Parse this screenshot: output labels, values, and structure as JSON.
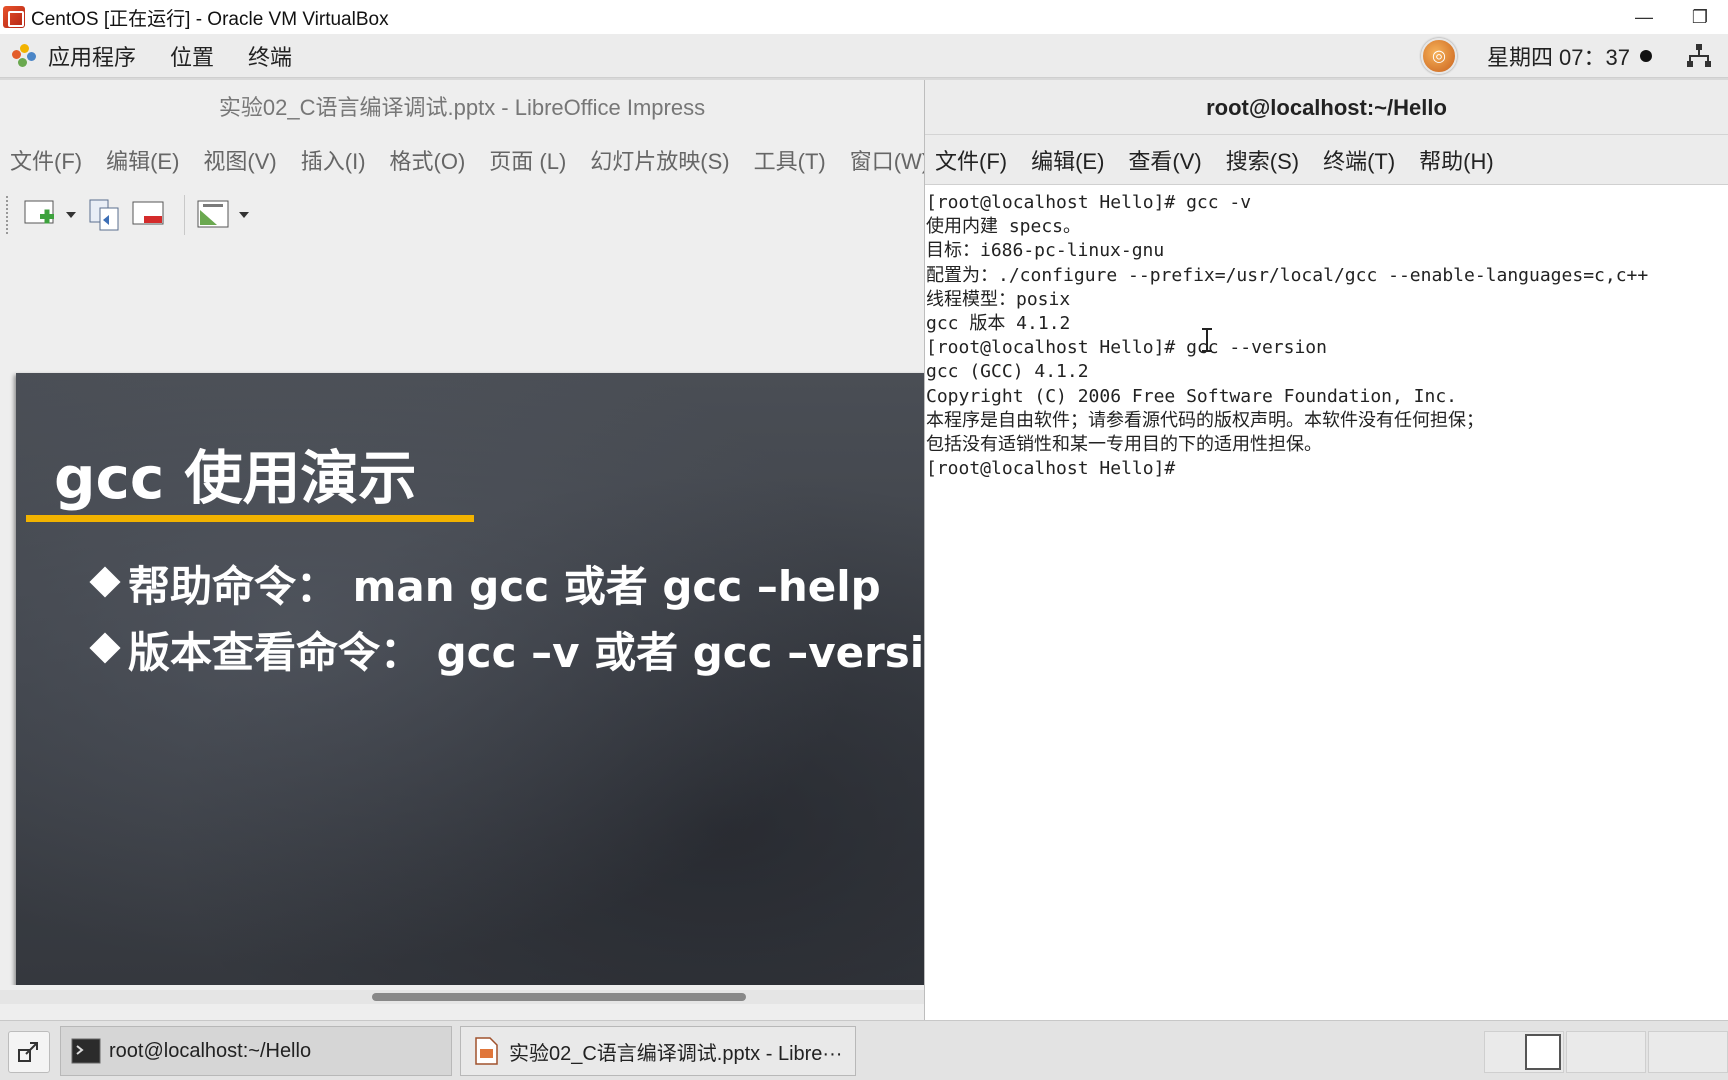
{
  "vbox": {
    "title": "CentOS [正在运行] - Oracle VM VirtualBox",
    "minimize": "—",
    "restore": "❐"
  },
  "topbar": {
    "applications": "应用程序",
    "places": "位置",
    "terminal": "终端",
    "clock": "星期四 07：37"
  },
  "impress": {
    "title": "实验02_C语言编译调试.pptx - LibreOffice Impress",
    "menu": [
      "文件(F)",
      "编辑(E)",
      "视图(V)",
      "插入(I)",
      "格式(O)",
      "页面 (L)",
      "幻灯片放映(S)",
      "工具(T)",
      "窗口(W)"
    ],
    "slide": {
      "title": "gcc 使用演示",
      "bullets": [
        "帮助命令： man gcc  或者 gcc –help",
        "版本查看命令：  gcc –v  或者  gcc –version"
      ]
    }
  },
  "terminal": {
    "title": "root@localhost:~/Hello",
    "menu": [
      "文件(F)",
      "编辑(E)",
      "查看(V)",
      "搜索(S)",
      "终端(T)",
      "帮助(H)"
    ],
    "lines": [
      "[root@localhost Hello]# gcc -v",
      "使用内建 specs。",
      "目标：i686-pc-linux-gnu",
      "配置为：./configure --prefix=/usr/local/gcc --enable-languages=c,c++",
      "线程模型：posix",
      "gcc 版本 4.1.2",
      "[root@localhost Hello]# gcc --version",
      "gcc (GCC) 4.1.2",
      "Copyright (C) 2006 Free Software Foundation, Inc.",
      "本程序是自由软件；请参看源代码的版权声明。本软件没有任何担保；",
      "包括没有适销性和某一专用目的下的适用性担保。",
      "[root@localhost Hello]#"
    ]
  },
  "taskbar": {
    "task_terminal": "root@localhost:~/Hello",
    "task_impress": "实验02_C语言编译调试.pptx - Libre···"
  },
  "colors": {
    "slide_accent": "#f2b300",
    "vbox_red": "#c9321b"
  }
}
